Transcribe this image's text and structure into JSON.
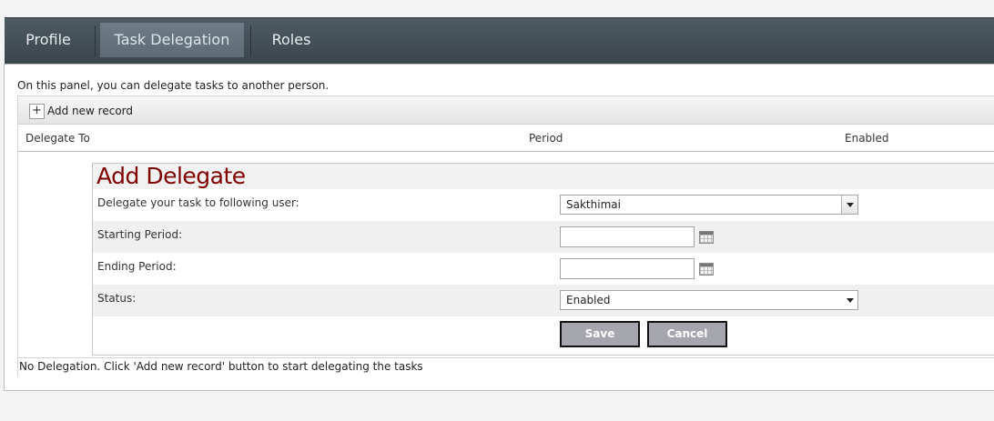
{
  "tabs": [
    {
      "label": "Profile"
    },
    {
      "label": "Task Delegation",
      "active": true
    },
    {
      "label": "Roles"
    }
  ],
  "panel": {
    "intro": "On this panel, you can delegate tasks to another person.",
    "add_new_record": "Add new record",
    "columns": [
      "Delegate To",
      "Period",
      "Enabled"
    ],
    "footer": "No Delegation. Click 'Add new record' button to start delegating the tasks"
  },
  "form": {
    "title": "Add Delegate",
    "delegate_label": "Delegate your task to following user:",
    "delegate_value": "Sakthimai",
    "start_label": "Starting Period:",
    "start_value": "",
    "end_label": "Ending Period:",
    "end_value": "",
    "status_label": "Status:",
    "status_value": "Enabled",
    "save": "Save",
    "cancel": "Cancel"
  },
  "colors": {
    "title": "#800000",
    "tabbar": "#3f4a51",
    "button": "#a5a5ad"
  },
  "icons": {
    "add": "plus-icon",
    "calendar": "calendar-icon",
    "dropdown": "chevron-down-icon"
  }
}
